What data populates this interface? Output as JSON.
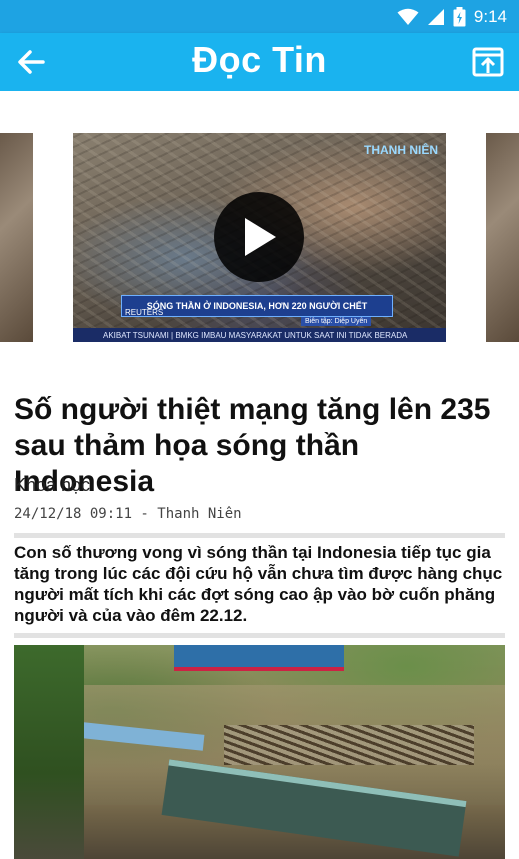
{
  "status_bar": {
    "time": "9:14",
    "icons": [
      "wifi-icon",
      "signal-icon",
      "battery-icon"
    ],
    "color": "#1ea3e3"
  },
  "app_bar": {
    "title": "Đọc Tin",
    "back_icon": "arrow-left-icon",
    "action_icon": "open-in-new-icon",
    "color": "#1ab3ef"
  },
  "video": {
    "headline_band": "SÓNG THẦN Ở INDONESIA, HƠN 220 NGƯỜI CHẾT",
    "editor": "Biên tập: Diệp Uyên",
    "ticker": "AKIBAT TSUNAMI  |  BMKG IMBAU MASYARAKAT UNTUK SAAT INI TIDAK BERADA",
    "source_logo": "THANH NIÊN",
    "agency": "REUTERS"
  },
  "article": {
    "title": "Số người thiệt mạng tăng lên 235 sau thảm họa sóng thần Indonesia",
    "category": "Khoa học",
    "meta": "24/12/18 09:11 - Thanh Niên",
    "summary": "Con số thương vong vì sóng thần tại Indonesia tiếp tục gia tăng trong lúc các đội cứu hộ vẫn chưa tìm được hàng chục người mất tích khi các đợt sóng cao ập vào bờ cuốn phăng người và của vào đêm 22.12."
  }
}
